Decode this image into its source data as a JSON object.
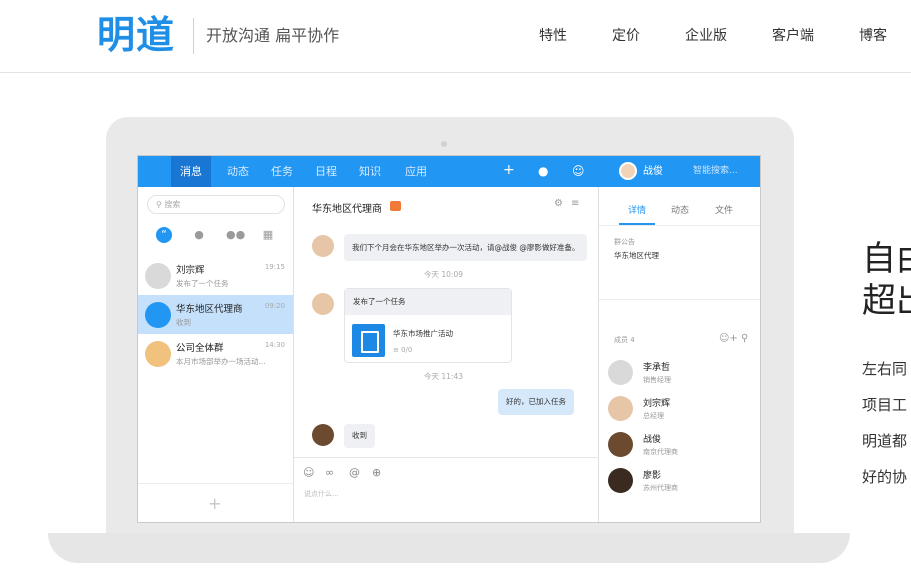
{
  "header": {
    "logo": "明道",
    "slogan": "开放沟通  扁平协作",
    "nav": [
      "特性",
      "定价",
      "企业版",
      "客户端",
      "博客"
    ]
  },
  "app": {
    "tabs": [
      "消息",
      "动态",
      "任务",
      "日程",
      "知识",
      "应用"
    ],
    "user_name": "战俊",
    "search_placeholder": "智能搜索...",
    "left": {
      "search_placeholder": "搜索",
      "conversations": [
        {
          "name": "刘宗辉",
          "preview": "发布了一个任务",
          "time": "19:15"
        },
        {
          "name": "华东地区代理商",
          "preview": "收到",
          "time": "09:20"
        },
        {
          "name": "公司全体群",
          "preview": "本月市场部举办一场活动...",
          "time": "14:30"
        }
      ],
      "add": "+"
    },
    "chat": {
      "title": "华东地区代理商",
      "messages": {
        "m1": "我们下个月会在华东地区举办一次活动，请@战俊 @廖影做好准备。",
        "t1": "今天 10:09",
        "m2_head": "发布了一个任务",
        "task_name": "华东市场推广活动",
        "task_progress": "0/0",
        "t2": "今天 11:43",
        "m3": "好的，已加入任务",
        "m4": "收到"
      },
      "composer_placeholder": "说点什么..."
    },
    "right": {
      "tabs": [
        "详情",
        "动态",
        "文件"
      ],
      "announcement_label": "群公告",
      "announcement": "华东地区代理",
      "members_label": "成员  4",
      "members": [
        {
          "name": "李承哲",
          "role": "销售经理"
        },
        {
          "name": "刘宗辉",
          "role": "总经理"
        },
        {
          "name": "战俊",
          "role": "南京代理商"
        },
        {
          "name": "廖影",
          "role": "苏州代理商"
        }
      ]
    }
  },
  "side": {
    "title_lines": [
      "自由",
      "超出"
    ],
    "lines": [
      "左右同",
      "项目工",
      "明道都",
      "好的协"
    ]
  }
}
